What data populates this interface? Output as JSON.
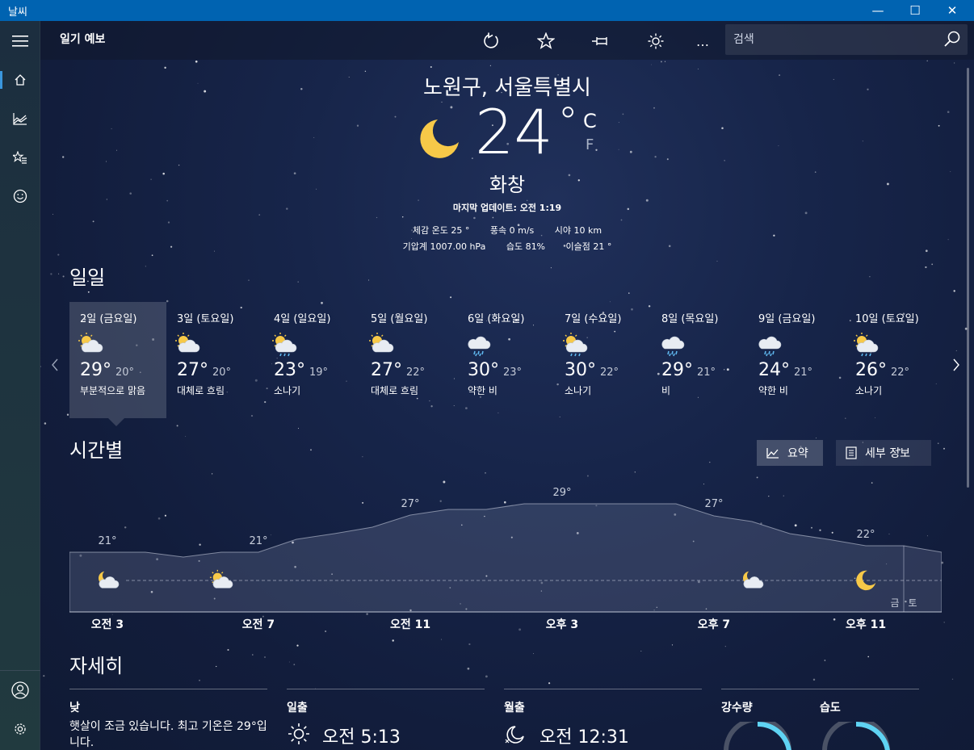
{
  "window": {
    "title": "날씨",
    "minimize": "—",
    "maximize": "☐",
    "close": "✕"
  },
  "nav": {
    "items": [
      {
        "name": "menu",
        "icon": "hamburger-icon"
      },
      {
        "name": "home",
        "icon": "home-icon"
      },
      {
        "name": "maps",
        "icon": "chart-icon"
      },
      {
        "name": "favorites",
        "icon": "star-list-icon"
      },
      {
        "name": "feedback",
        "icon": "smile-icon"
      },
      {
        "name": "account",
        "icon": "user-icon"
      },
      {
        "name": "settings",
        "icon": "gear-icon"
      }
    ]
  },
  "header": {
    "title": "일기 예보",
    "search_placeholder": "검색",
    "more": "…"
  },
  "current": {
    "location": "노원구, 서울특별시",
    "temperature": "24",
    "degree": "°",
    "unit_c": "C",
    "unit_f": "F",
    "condition": "화창",
    "updated": "마지막 업데이트: 오전 1:19",
    "details_row1": [
      "체감 온도  25 °",
      "풍속   0 m/s",
      "시야  10 km"
    ],
    "details_row2": [
      "기압계  1007.00 hPa",
      "습도   81%",
      "이슬점   21 °"
    ]
  },
  "daily": {
    "heading": "일일",
    "days": [
      {
        "date": "2일 (금요일)",
        "hi": "29°",
        "lo": "20°",
        "condition": "부분적으로 맑음",
        "icon": "partly-sunny-icon"
      },
      {
        "date": "3일 (토요일)",
        "hi": "27°",
        "lo": "20°",
        "condition": "대체로 흐림",
        "icon": "partly-sunny-icon"
      },
      {
        "date": "4일 (일요일)",
        "hi": "23°",
        "lo": "19°",
        "condition": "소나기",
        "icon": "sun-rain-icon"
      },
      {
        "date": "5일 (월요일)",
        "hi": "27°",
        "lo": "22°",
        "condition": "대체로 흐림",
        "icon": "partly-sunny-icon"
      },
      {
        "date": "6일 (화요일)",
        "hi": "30°",
        "lo": "23°",
        "condition": "약한 비",
        "icon": "rain-icon"
      },
      {
        "date": "7일 (수요일)",
        "hi": "30°",
        "lo": "22°",
        "condition": "소나기",
        "icon": "sun-rain-icon"
      },
      {
        "date": "8일 (목요일)",
        "hi": "29°",
        "lo": "21°",
        "condition": "비",
        "icon": "rain-icon"
      },
      {
        "date": "9일 (금요일)",
        "hi": "24°",
        "lo": "21°",
        "condition": "약한 비",
        "icon": "rain-icon"
      },
      {
        "date": "10일 (토요일)",
        "hi": "26°",
        "lo": "22°",
        "condition": "소나기",
        "icon": "sun-rain-icon"
      }
    ]
  },
  "hourly": {
    "heading": "시간별",
    "summary_label": "요약",
    "details_label": "세부 정보",
    "time_labels": [
      "오전 3",
      "오전 7",
      "오전 11",
      "오후 3",
      "오후 7",
      "오후 11"
    ],
    "temp_labels": [
      "21°",
      "21°",
      "27°",
      "29°",
      "27°",
      "22°"
    ],
    "day_labels": [
      "금",
      "토"
    ],
    "icons": [
      "moon-cloud-icon",
      "partly-cloudy-icon",
      "moon-cloud-icon",
      "moon-icon"
    ]
  },
  "details": {
    "heading": "자세히",
    "day": {
      "title": "낮",
      "text": "햇살이 조금 있습니다. 최고 기온은 29°입니다."
    },
    "sunrise": {
      "title": "일출",
      "value": "오전 5:13"
    },
    "moonrise": {
      "title": "월출",
      "value": "오전 12:31"
    },
    "precip": {
      "title": "강수량"
    },
    "humidity": {
      "title": "습도"
    }
  },
  "colors": {
    "accent": "#0063b1",
    "gauge": "#5fd3f3",
    "moon": "#f7c948"
  }
}
